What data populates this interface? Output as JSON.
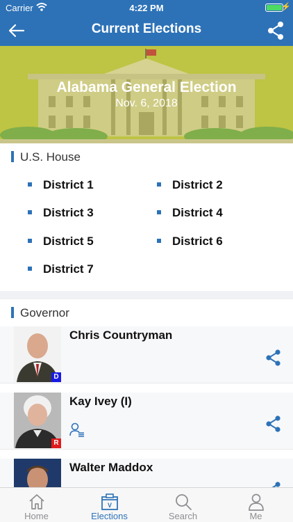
{
  "status": {
    "carrier": "Carrier",
    "time": "4:22 PM"
  },
  "nav": {
    "title": "Current Elections",
    "back_icon": "arrow-left-icon",
    "share_icon": "share-icon"
  },
  "banner": {
    "title": "Alabama General Election",
    "date": "Nov. 6, 2018"
  },
  "us_house": {
    "label": "U.S. House",
    "districts": [
      "District 1",
      "District 2",
      "District 3",
      "District 4",
      "District 5",
      "District 6",
      "District 7"
    ]
  },
  "governor": {
    "label": "Governor",
    "candidates": [
      {
        "name": "Chris Countryman",
        "party": "D"
      },
      {
        "name": "Kay Ivey (I)",
        "party": "R"
      },
      {
        "name": "Walter Maddox"
      }
    ]
  },
  "tabs": [
    {
      "label": "Home",
      "icon": "home-icon"
    },
    {
      "label": "Elections",
      "icon": "ballot-box-icon",
      "active": true,
      "icon_letter": "V"
    },
    {
      "label": "Search",
      "icon": "search-icon"
    },
    {
      "label": "Me",
      "icon": "person-icon"
    }
  ],
  "colors": {
    "brand": "#2d72b7",
    "banner": "#bec444",
    "democrat": "#1a1ae6",
    "republican": "#e01b1b"
  }
}
